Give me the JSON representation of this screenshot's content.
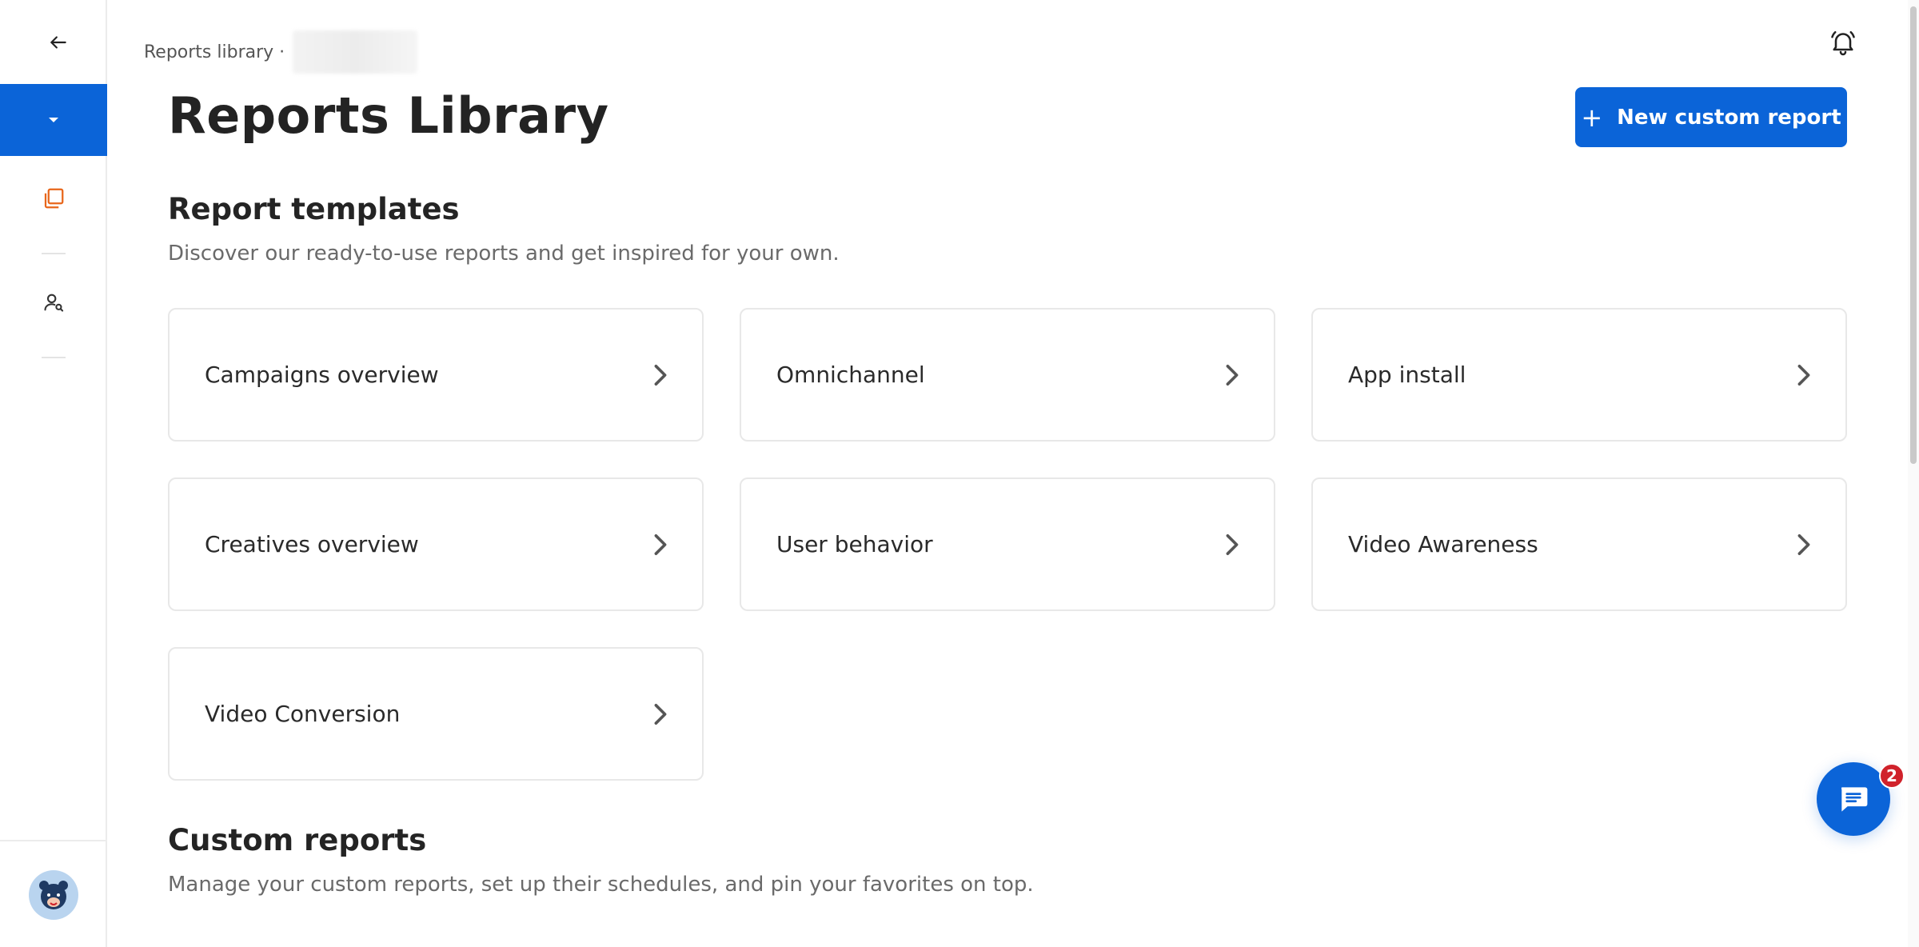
{
  "sidebar": {
    "back_icon": "arrow-left-icon",
    "active_icon": "caret-down-icon",
    "reports_icon": "library-icon",
    "audience_icon": "user-search-icon",
    "avatar_icon": "bear-avatar",
    "active_color": "#0b64d8",
    "reports_icon_color": "#e8661a"
  },
  "header": {
    "breadcrumb": "Reports library ·",
    "bell_icon": "bell-ring-icon"
  },
  "main": {
    "title": "Reports Library",
    "new_button_label": "New custom report",
    "new_button_icon": "plus-icon",
    "templates": {
      "title": "Report templates",
      "subtitle": "Discover our ready-to-use reports and get inspired for your own.",
      "cards": [
        {
          "label": "Campaigns overview"
        },
        {
          "label": "Omnichannel"
        },
        {
          "label": "App install"
        },
        {
          "label": "Creatives overview"
        },
        {
          "label": "User behavior"
        },
        {
          "label": "Video Awareness"
        },
        {
          "label": "Video Conversion"
        }
      ]
    },
    "custom": {
      "title": "Custom reports",
      "subtitle": "Manage your custom reports, set up their schedules, and pin your favorites on top."
    }
  },
  "chat": {
    "icon": "chat-bubble-icon",
    "badge_count": "2",
    "accent": "#0b64d8",
    "badge_color": "#d0222b"
  }
}
